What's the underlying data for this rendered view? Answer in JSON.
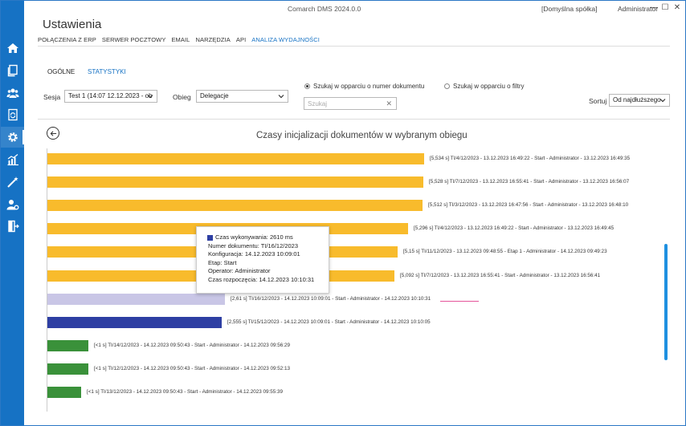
{
  "window": {
    "app_title": "Comarch DMS 2024.0.0",
    "company": "[Domyślna spółka]",
    "user": "Administrator",
    "minimize": "—",
    "maximize": "☐",
    "close": "✕"
  },
  "page_title": "Ustawienia",
  "menu": [
    "POŁĄCZENIA Z ERP",
    "SERWER POCZTOWY",
    "EMAIL",
    "NARZĘDZIA",
    "API",
    "ANALIZA WYDAJNOŚCI"
  ],
  "tabs": [
    "OGÓLNE",
    "STATYSTYKI"
  ],
  "filters": {
    "session_label": "Sesja",
    "session_value": "Test 1 (14:07 12.12.2023 - ob",
    "workflow_label": "Obieg",
    "workflow_value": "Delegacje",
    "radio_doc": "Szukaj w opparciu o numer dokumentu",
    "radio_filters": "Szukaj w opparciu o filtry",
    "search_placeholder": "Szukaj",
    "sort_label": "Sortuj",
    "sort_value": "Od najdłuższego"
  },
  "chart_title": "Czasy inicjalizacji dokumentów w wybranym obiegu",
  "bars": [
    {
      "label": "[5,534 s] TI/4/12/2023 - 13.12.2023 16:49:22 - Start - Administrator - 13.12.2023 16:49:35",
      "value": 5.534,
      "color": "#f8bb2c"
    },
    {
      "label": "[5,528 s] TI/7/12/2023 - 13.12.2023 16:55:41 - Start - Administrator - 13.12.2023 16:56:07",
      "value": 5.528,
      "color": "#f8bb2c"
    },
    {
      "label": "[5,512 s] TI/3/12/2023 - 13.12.2023 16:47:56 - Start - Administrator - 13.12.2023 16:48:10",
      "value": 5.512,
      "color": "#f8bb2c"
    },
    {
      "label": "[5,296 s] TI/4/12/2023 - 13.12.2023 16:49:22 - Start - Administrator - 13.12.2023 16:49:45",
      "value": 5.296,
      "color": "#f8bb2c"
    },
    {
      "label": "[5,15 s] TI/11/12/2023 - 13.12.2023 09:48:55 - Etap 1 - Administrator - 14.12.2023 09:49:23",
      "value": 5.15,
      "color": "#f8bb2c"
    },
    {
      "label": "[5,092 s] TI/7/12/2023 - 13.12.2023 16:55:41 - Start - Administrator - 13.12.2023 16:56:41",
      "value": 5.092,
      "color": "#f8bb2c"
    },
    {
      "label": "[2,61 s] TI/16/12/2023 - 14.12.2023 10:09:01 - Start - Administrator - 14.12.2023 10:10:31",
      "value": 2.61,
      "color": "#c9c6e6"
    },
    {
      "label": "[2,555 s] TI/15/12/2023 - 14.12.2023 10:09:01 - Start - Administrator - 14.12.2023 10:10:05",
      "value": 2.555,
      "color": "#2e3fa3"
    },
    {
      "label": "[<1 s] TI/14/12/2023 - 14.12.2023 09:50:43 - Start - Administrator - 14.12.2023 09:56:29",
      "value": 0.6,
      "color": "#3a913a"
    },
    {
      "label": "[<1 s] TI/12/12/2023 - 14.12.2023 09:50:43 - Start - Administrator - 14.12.2023 09:52:13",
      "value": 0.6,
      "color": "#3a913a"
    },
    {
      "label": "[<1 s] TI/13/12/2023 - 14.12.2023 09:50:43 - Start - Administrator - 14.12.2023 09:55:39",
      "value": 0.5,
      "color": "#3a913a"
    }
  ],
  "tooltip": {
    "line1": "Czas wykonywania: 2610 ms",
    "line2": "Numer dokumentu: TI/16/12/2023",
    "line3": "Konfiguracja: 14.12.2023 10:09:01",
    "line4": "Etap: Start",
    "line5": "Operator: Administrator",
    "line6": "Czas rozpoczęcia: 14.12.2023 10:10:31"
  },
  "sidebar_icons": [
    "home-icon",
    "documents-icon",
    "users-icon",
    "settings-icon",
    "statistics-icon",
    "wand-icon",
    "user-settings-icon",
    "logout-icon"
  ]
}
